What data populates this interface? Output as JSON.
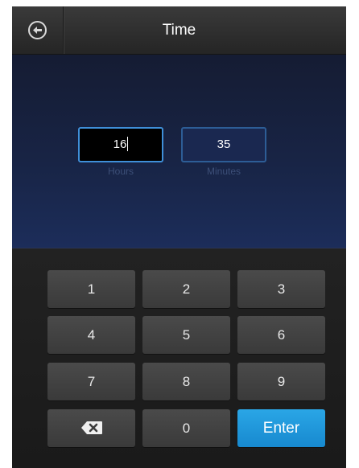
{
  "header": {
    "title": "Time",
    "back_icon": "back-arrow-icon"
  },
  "time_entry": {
    "hours": {
      "value": "16",
      "label": "Hours",
      "focused": true
    },
    "minutes": {
      "value": "35",
      "label": "Minutes",
      "focused": false
    }
  },
  "keypad": {
    "keys": [
      "1",
      "2",
      "3",
      "4",
      "5",
      "6",
      "7",
      "8",
      "9",
      "0"
    ],
    "delete_icon": "backspace-icon",
    "enter_label": "Enter"
  },
  "colors": {
    "accent": "#1f96db",
    "header_bg": "#2e2e2e",
    "panel_bg": "#182445",
    "key_bg": "#424242",
    "field_border": "#3f8fd8"
  }
}
